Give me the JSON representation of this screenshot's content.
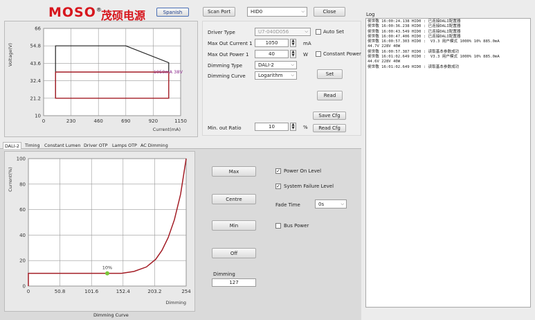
{
  "header": {
    "logo_text": "MOSO",
    "logo_registered": "®",
    "brand_cn": "茂硕电源",
    "language_button": "Spanish",
    "scan_port_button": "Scan Port",
    "port_value": "HID0",
    "close_button": "Close"
  },
  "top_chart": {
    "y_axis_label": "Voltage(V)",
    "x_axis_label": "Current(mA)",
    "x_ticks": [
      "0",
      "230",
      "460",
      "690",
      "920",
      "1150"
    ],
    "y_ticks": [
      "10",
      "21.2",
      "32.4",
      "43.6",
      "54.8",
      "66"
    ],
    "annotation": "1050mA 38V"
  },
  "chart_data": [
    {
      "type": "line",
      "title": "",
      "xlabel": "Current(mA)",
      "ylabel": "Voltage(V)",
      "xlim": [
        0,
        1150
      ],
      "ylim": [
        10,
        66
      ],
      "grid": true,
      "series": [
        {
          "x": [
            100,
            100,
            690,
            1050,
            1050
          ],
          "y": [
            21.2,
            54.8,
            54.8,
            44,
            38
          ]
        },
        {
          "x": [
            100,
            1050,
            1050,
            100,
            100
          ],
          "y": [
            38,
            38,
            21.2,
            21.2,
            38
          ]
        }
      ],
      "annotations": [
        {
          "text": "1050mA 38V",
          "x": 1050,
          "y": 38
        }
      ]
    },
    {
      "type": "line",
      "title": "",
      "xlabel": "Dimming",
      "ylabel": "Current(%)",
      "xlim": [
        0,
        254
      ],
      "ylim": [
        0,
        100
      ],
      "grid": true,
      "series": [
        {
          "x": [
            0,
            0,
            127,
            150,
            170,
            190,
            205,
            215,
            225,
            235,
            245,
            254
          ],
          "y": [
            0,
            10,
            10,
            10,
            11.5,
            15,
            21,
            28,
            38,
            52,
            72,
            100
          ]
        }
      ],
      "annotations": [
        {
          "text": "10%",
          "x": 127,
          "y": 10
        }
      ]
    }
  ],
  "driver": {
    "driver_type_label": "Driver Type",
    "driver_type_value": "U7-040D056",
    "auto_set_label": "Auto Set",
    "max_out_current_label": "Max Out Current 1",
    "max_out_current_value": "1050",
    "max_out_current_unit": "mA",
    "max_out_power_label": "Max Out Power 1",
    "max_out_power_value": "40",
    "max_out_power_unit": "W",
    "constant_power_label": "Constant Power",
    "dimming_type_label": "Dimming Type",
    "dimming_type_value": "DALI-2",
    "dimming_curve_label": "Dimming Curve",
    "dimming_curve_value": "Logarithm",
    "set_button": "Set",
    "read_button": "Read",
    "save_cfg_button": "Save Cfg",
    "read_cfg_button": "Read Cfg",
    "min_out_ratio_label": "Min. out Ratio",
    "min_out_ratio_value": "10",
    "min_out_ratio_unit": "%"
  },
  "tabs": [
    "DALI-2",
    "Timing",
    "Constant Lumen",
    "Driver OTP",
    "Lamps OTP",
    "AC Dimming"
  ],
  "bottom_chart": {
    "y_axis_label": "Current(%)",
    "x_axis_label": "Dimming",
    "x_ticks": [
      "0",
      "50.8",
      "101.6",
      "152.4",
      "203.2",
      "254"
    ],
    "y_ticks": [
      "0",
      "20",
      "40",
      "60",
      "80",
      "100"
    ],
    "annotation": "10%",
    "caption": "Dimming Curve"
  },
  "dali": {
    "max_button": "Max",
    "centre_button": "Centre",
    "min_button": "Min",
    "off_button": "Off",
    "dimming_label": "Dimming",
    "dimming_value": "127",
    "power_on_level_label": "Power On Level",
    "system_failure_level_label": "System Failure Level",
    "fade_time_label": "Fade Time",
    "fade_time_value": "0s",
    "bus_power_label": "Bus Power"
  },
  "log": {
    "title": "Log",
    "lines": [
      "侯世敬 16:00:24.138 HID0 : 已连接DALI配置器",
      "侯世敬 16:00:36.238 HID0 : 已连接DALI配置器",
      "侯世敬 16:00:43.549 HID0 : 已连接DALI配置器",
      "侯世敬 16:00:47.406 HID0 : 已连接DALI配置器",
      "侯世敬 16:00:57.303 HID0 :  V3.3 用户模式 1000% 10% 885.0mA",
      "44.7V 228V 40W",
      "侯世敬 16:00:57.387 HID0 : 读取基本参数成功",
      "侯世敬 16:01:02.649 HID0 :  V3.3 用户模式 1000% 10% 885.0mA",
      "44.6V 228V 40W",
      "侯世敬 16:01:02.649 HID0 : 读取基本参数成功"
    ]
  }
}
